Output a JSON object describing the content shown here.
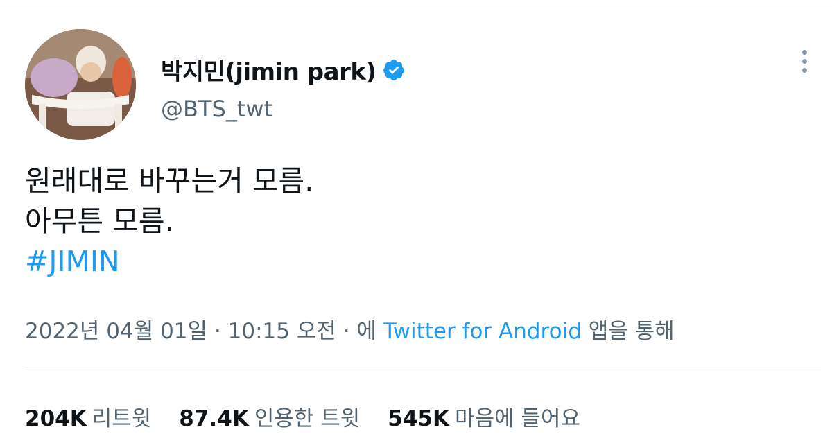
{
  "author": {
    "display_name": "박지민(jimin park)",
    "handle": "@BTS_twt",
    "verified": true
  },
  "tweet": {
    "lines": [
      "원래대로 바꾸는거 모름.",
      "아무튼 모름."
    ],
    "hashtag": "#JIMIN"
  },
  "meta": {
    "date": "2022년 04월 01일",
    "sep1": " · ",
    "time": "10:15 오전",
    "sep2": " · ",
    "via_prefix": "에 ",
    "source": "Twitter for Android",
    "via_suffix": " 앱을 통해"
  },
  "stats": [
    {
      "count": "204K",
      "label": "리트윗"
    },
    {
      "count": "87.4K",
      "label": "인용한 트윗"
    },
    {
      "count": "545K",
      "label": "마음에 들어요"
    }
  ],
  "colors": {
    "accent": "#1d9bf0",
    "secondary_text": "#536471",
    "primary_text": "#0f1419"
  },
  "icons": {
    "verified": "verified-badge-icon",
    "more": "more-options-icon"
  }
}
